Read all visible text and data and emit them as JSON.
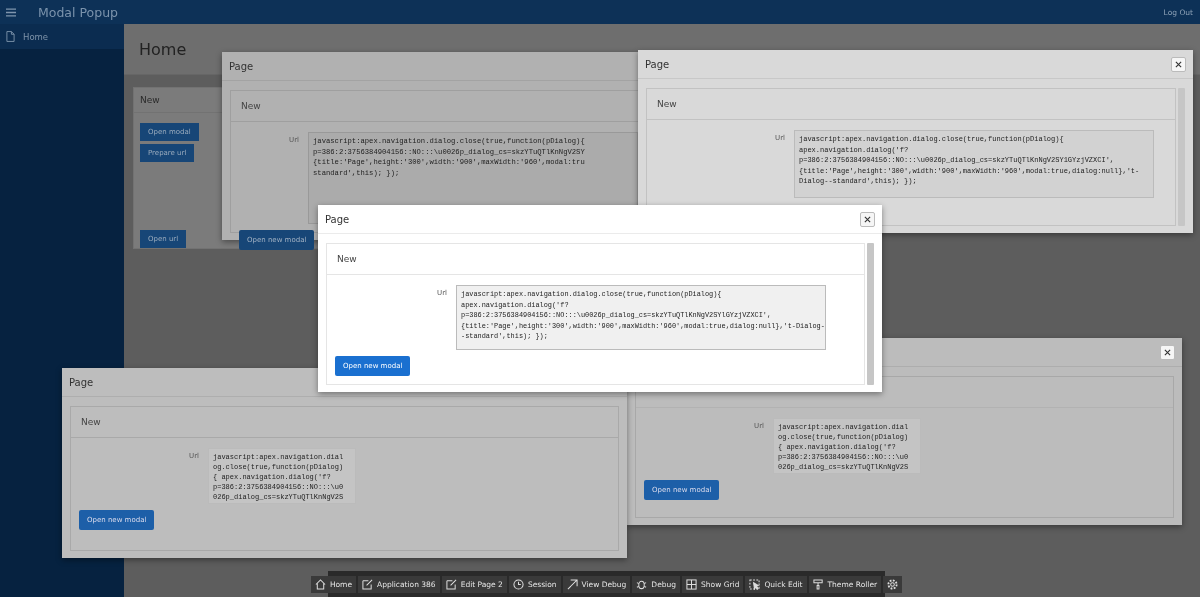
{
  "header": {
    "title": "Modal Popup",
    "logout": "Log Out"
  },
  "sidebar": {
    "items": [
      {
        "label": "Home",
        "selected": true
      }
    ]
  },
  "page": {
    "title": "Home",
    "region": {
      "title": "New",
      "buttons": [
        "Open modal",
        "Prepare url",
        "Open url"
      ]
    }
  },
  "dialogs": [
    {
      "title": "Page",
      "region_title": "New",
      "url_label": "Url",
      "url_lines": [
        "javascript:apex.navigation.dialog.close(true,function(pDialog){",
        "p=386:2:3756384904156::NO:::\\u0026p_dialog_cs=skzYTuQTlKnNgV2SY",
        "{title:'Page',height:'300',width:'900',maxWidth:'960',modal:tru",
        "standard',this); });"
      ],
      "button": "Open new modal",
      "has_close": false,
      "scrollbar": false
    },
    {
      "title": "Page",
      "region_title": "New",
      "url_label": "Url",
      "url_lines": [
        "javascript:apex.navigation.dialog.close(true,function(pDialog){",
        "apex.navigation.dialog('f?",
        "p=386:2:3756384904156::NO:::\\u0026p_dialog_cs=skzYTuQTlKnNgV2SY1GYzjVZXCI',",
        "{title:'Page',height:'300',width:'900',maxWidth:'960',modal:true,dialog:null},'t-",
        "Dialog--standard',this); });"
      ],
      "has_close": true,
      "scrollbar": true
    },
    {
      "url_label": "Url",
      "url_lines": [
        "javascript:apex.navigation.dial",
        "og.close(true,function(pDialog)",
        "{ apex.navigation.dialog('f?",
        "p=386:2:3756384904156::NO:::\\u0",
        "026p_dialog_cs=skzYTuQTlKnNgV2S"
      ],
      "button": "Open new modal",
      "has_close": true,
      "scrollbar": false
    },
    {
      "title": "Page",
      "region_title": "New",
      "url_label": "Url",
      "url_lines": [
        "javascript:apex.navigation.dial",
        "og.close(true,function(pDialog)",
        "{ apex.navigation.dialog('f?",
        "p=386:2:3756384904156::NO:::\\u0",
        "026p_dialog_cs=skzYTuQTlKnNgV2S"
      ],
      "button": "Open new modal",
      "has_close": false,
      "scrollbar": false
    },
    {
      "title": "Page",
      "region_title": "New",
      "url_label": "Url",
      "url_lines": [
        "javascript:apex.navigation.dialog.close(true,function(pDialog){",
        "apex.navigation.dialog('f?",
        "p=386:2:3756384904156::NO:::\\u0026p_dialog_cs=skzYTuQTlKnNgV2SYlGYzjVZXCI',",
        "{title:'Page',height:'300',width:'900',maxWidth:'960',modal:true,dialog:null},'t-Dialog-",
        "-standard',this); });"
      ],
      "button": "Open new modal",
      "has_close": true,
      "scrollbar": true
    }
  ],
  "dev_toolbar": {
    "items": [
      {
        "kind": "home",
        "label": "Home"
      },
      {
        "kind": "app",
        "label": "Application 386"
      },
      {
        "kind": "edit",
        "label": "Edit Page 2"
      },
      {
        "kind": "session",
        "label": "Session"
      },
      {
        "kind": "view-debug",
        "label": "View Debug"
      },
      {
        "kind": "debug",
        "label": "Debug"
      },
      {
        "kind": "grid",
        "label": "Show Grid"
      },
      {
        "kind": "quick-edit",
        "label": "Quick Edit"
      },
      {
        "kind": "theme",
        "label": "Theme Roller"
      },
      {
        "kind": "settings"
      }
    ]
  }
}
